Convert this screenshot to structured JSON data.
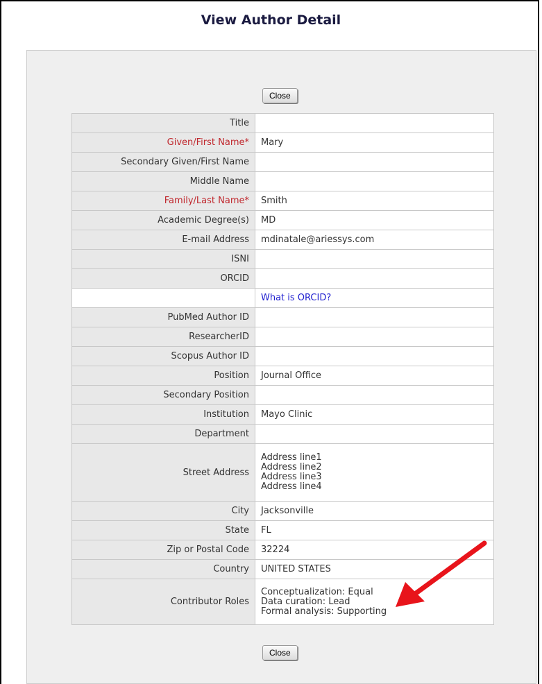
{
  "page": {
    "title": "View Author Detail"
  },
  "buttons": {
    "close_label": "Close"
  },
  "fields": {
    "title": {
      "label": "Title",
      "value": ""
    },
    "given_name": {
      "label": "Given/First Name*",
      "value": "Mary"
    },
    "secondary_given_name": {
      "label": "Secondary Given/First Name",
      "value": ""
    },
    "middle_name": {
      "label": "Middle Name",
      "value": ""
    },
    "family_name": {
      "label": "Family/Last Name*",
      "value": "Smith"
    },
    "academic_degrees": {
      "label": "Academic Degree(s)",
      "value": "MD"
    },
    "email": {
      "label": "E-mail Address",
      "value": "mdinatale@ariessys.com"
    },
    "isni": {
      "label": "ISNI",
      "value": ""
    },
    "orcid": {
      "label": "ORCID",
      "value": "",
      "help_link": "What is ORCID?"
    },
    "pubmed_id": {
      "label": "PubMed Author ID",
      "value": ""
    },
    "researcher_id": {
      "label": "ResearcherID",
      "value": ""
    },
    "scopus_id": {
      "label": "Scopus Author ID",
      "value": ""
    },
    "position": {
      "label": "Position",
      "value": "Journal Office"
    },
    "secondary_position": {
      "label": "Secondary Position",
      "value": ""
    },
    "institution": {
      "label": "Institution",
      "value": "Mayo Clinic"
    },
    "department": {
      "label": "Department",
      "value": ""
    },
    "street_address": {
      "label": "Street Address",
      "lines": [
        "Address line1",
        "Address line2",
        "Address line3",
        "Address line4"
      ]
    },
    "city": {
      "label": "City",
      "value": "Jacksonville"
    },
    "state": {
      "label": "State",
      "value": "FL"
    },
    "zip": {
      "label": "Zip or Postal Code",
      "value": "32224"
    },
    "country": {
      "label": "Country",
      "value": "UNITED STATES"
    },
    "contributor_roles": {
      "label": "Contributor Roles",
      "lines": [
        "Conceptualization: Equal",
        "Data curation: Lead",
        "Formal analysis: Supporting"
      ]
    }
  },
  "colors": {
    "required_label": "#c0272d",
    "link": "#2020d0",
    "annotation_arrow": "#e8141b"
  }
}
